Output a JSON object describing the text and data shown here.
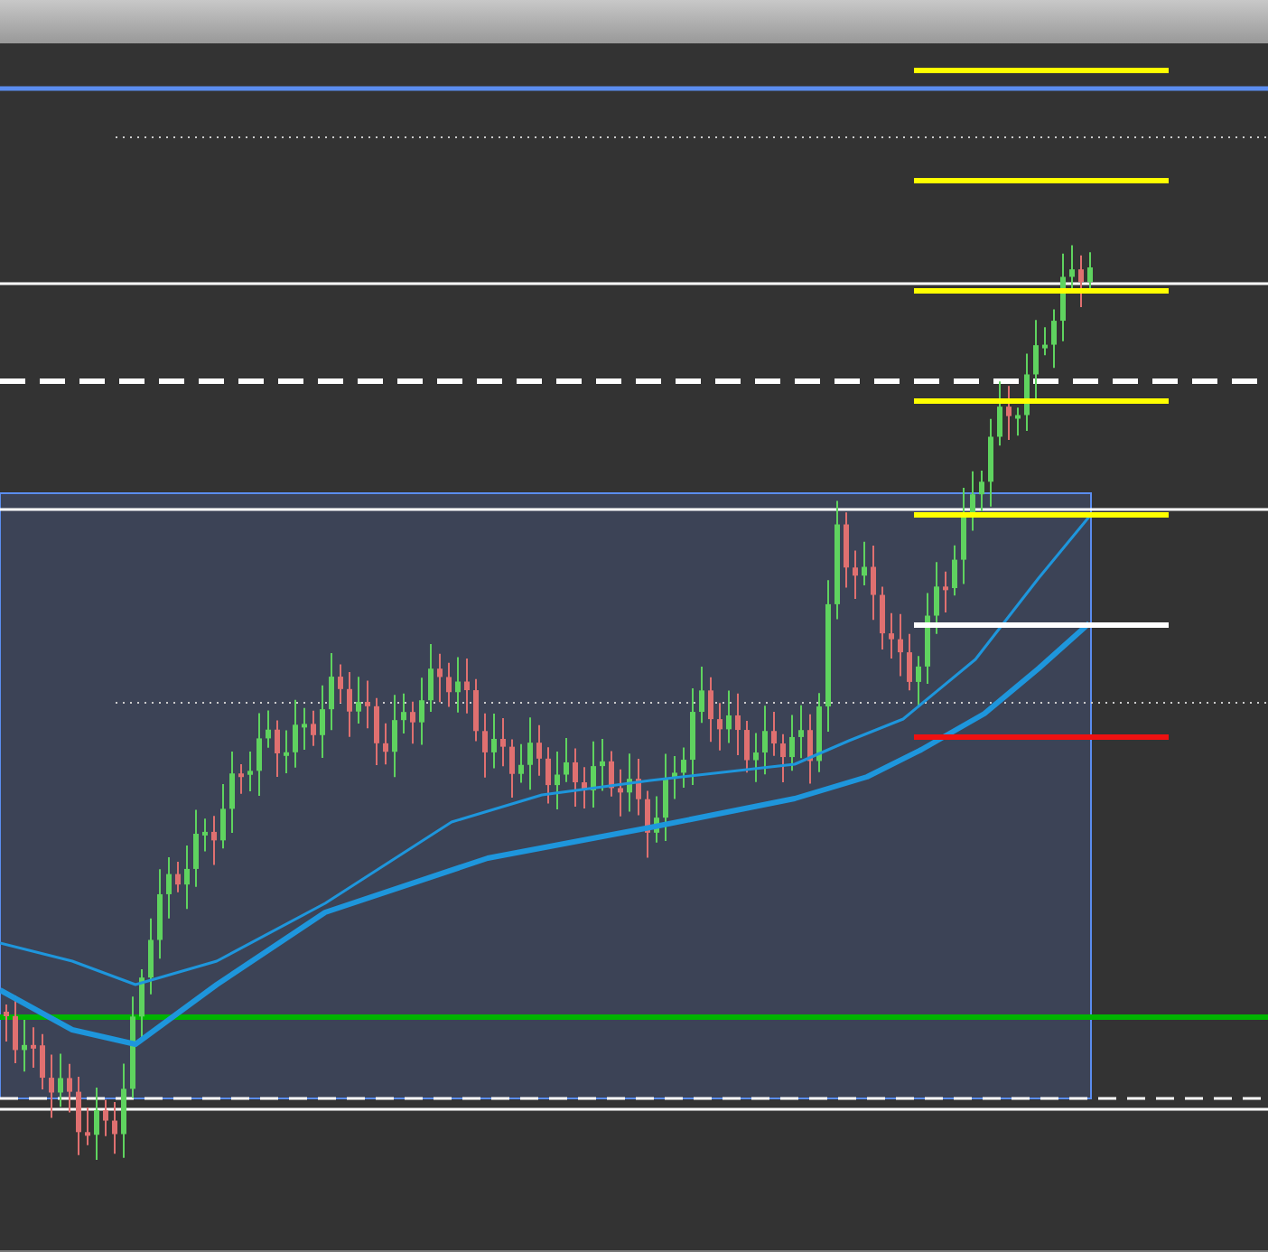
{
  "chart": {
    "levels": [
      {
        "kind": "solid",
        "color": "#5b8def"
      },
      {
        "kind": "dotted",
        "color": "#cccccc"
      },
      {
        "kind": "solid",
        "color": "#ffffff"
      },
      {
        "kind": "dashed",
        "color": "#ffffff"
      },
      {
        "kind": "solid",
        "color": "#ffffff"
      },
      {
        "kind": "dotted",
        "color": "#cccccc"
      },
      {
        "kind": "solid",
        "color": "#00b400"
      },
      {
        "kind": "dashed",
        "color": "#ffffff"
      },
      {
        "kind": "solid",
        "color": "#ffffff"
      }
    ],
    "fib_levels": [
      {
        "color": "#ffff00"
      },
      {
        "color": "#ffff00"
      },
      {
        "color": "#ffff00"
      },
      {
        "color": "#ffff00"
      },
      {
        "color": "#ffff00"
      },
      {
        "color": "#ffffff"
      },
      {
        "color": "#ee1111"
      }
    ]
  }
}
